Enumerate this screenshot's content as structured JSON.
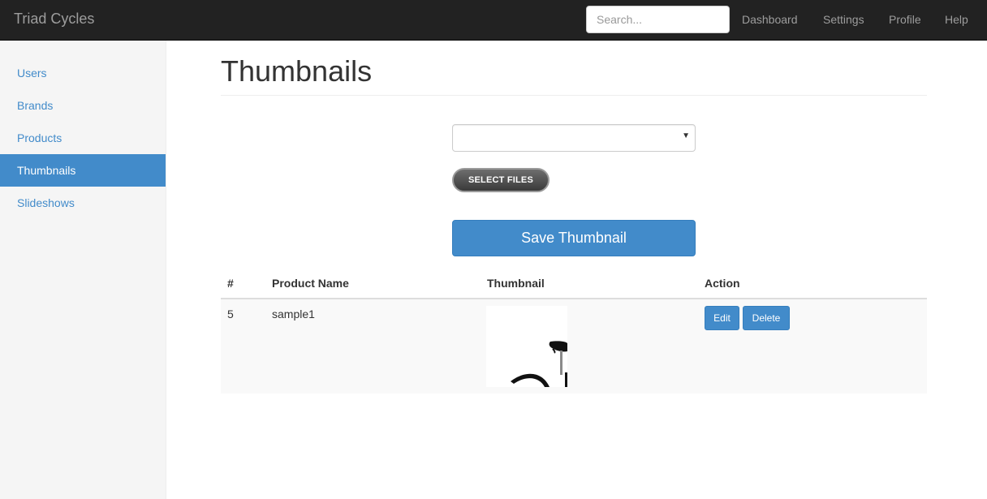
{
  "app": {
    "brand": "Triad Cycles"
  },
  "topnav": {
    "search_placeholder": "Search...",
    "links": [
      "Dashboard",
      "Settings",
      "Profile",
      "Help"
    ]
  },
  "sidebar": {
    "items": [
      {
        "label": "Users",
        "active": false
      },
      {
        "label": "Brands",
        "active": false
      },
      {
        "label": "Products",
        "active": false
      },
      {
        "label": "Thumbnails",
        "active": true
      },
      {
        "label": "Slideshows",
        "active": false
      }
    ]
  },
  "main": {
    "title": "Thumbnails",
    "product_select_value": "",
    "select_files_label": "SELECT FILES",
    "save_label": "Save Thumbnail",
    "table": {
      "headers": [
        "#",
        "Product Name",
        "Thumbnail",
        "Action"
      ],
      "rows": [
        {
          "id": "5",
          "name": "sample1",
          "thumbnail_icon": "bicycle-thumbnail",
          "edit_label": "Edit",
          "delete_label": "Delete"
        }
      ]
    }
  },
  "colors": {
    "primary": "#428bca",
    "navbar": "#222222",
    "sidebar": "#f5f5f5"
  }
}
